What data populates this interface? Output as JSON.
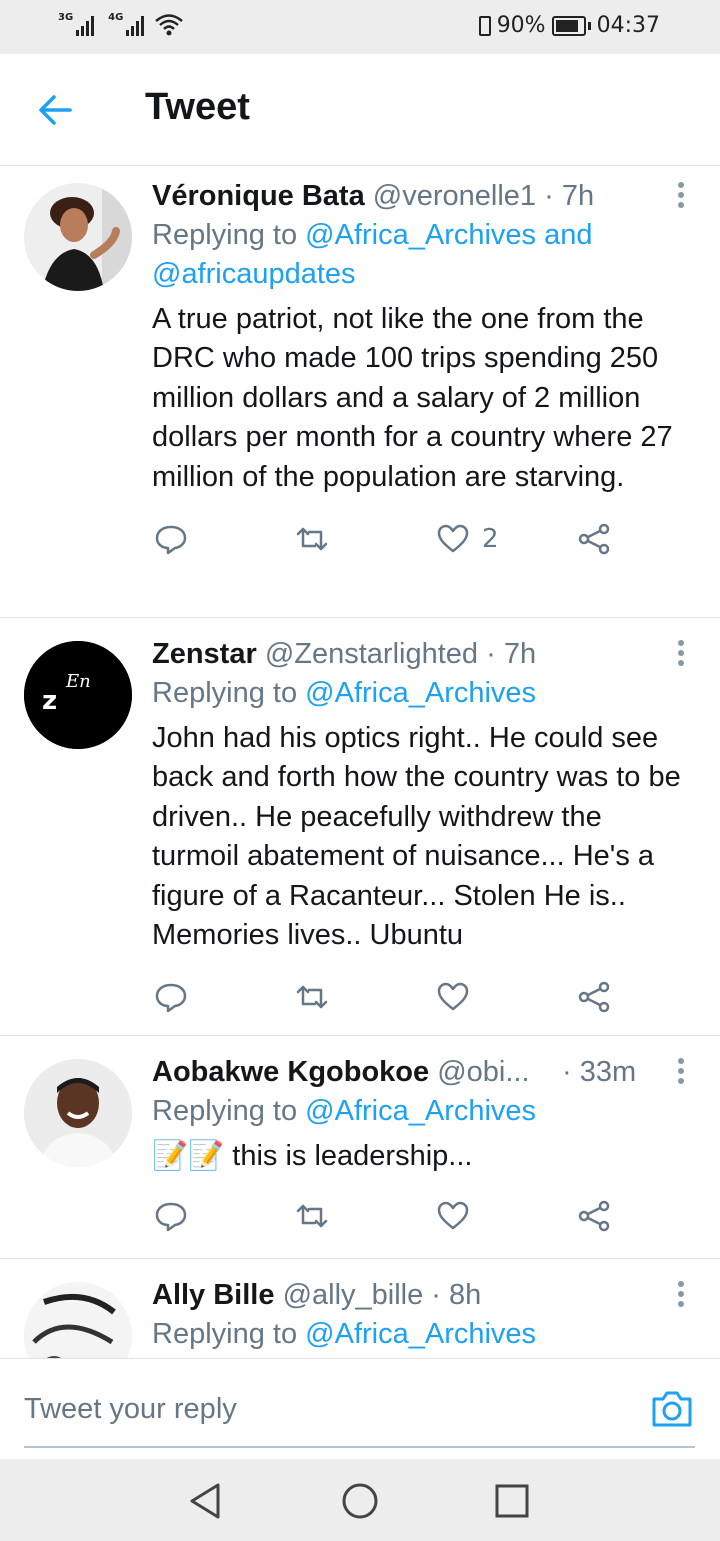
{
  "status_bar": {
    "net1": "3G",
    "net2": "4G",
    "battery": "90%",
    "time": "04:37"
  },
  "header": {
    "title": "Tweet"
  },
  "tweets": [
    {
      "name": "Véronique Bata",
      "handle": "@veronelle1",
      "sep": " · ",
      "time": "7h",
      "replying_prefix": "Replying to ",
      "replying_line1": "@Africa_Archives and",
      "replying_line2": "@africaupdates",
      "text": "A true patriot, not like the one from the DRC who made 100 trips spending 250 million dollars and a salary of 2 million dollars per month for a country where 27 million of the population are starving.",
      "likes": "2"
    },
    {
      "name": "Zenstar",
      "handle": "@Zenstarlighted",
      "sep": " · ",
      "time": "7h",
      "replying_prefix": "Replying to ",
      "replying_line1": "@Africa_Archives",
      "avatar_text_main": "z",
      "avatar_text_sup": "En",
      "text": "John had his optics right.. He could see back and forth how the country was to be driven.. He peacefully withdrew the turmoil abatement of nuisance... He's a figure of a Racanteur... Stolen He is.. Memories lives.. Ubuntu",
      "likes": ""
    },
    {
      "name": "Aobakwe Kgobokoe",
      "handle": "@obi...",
      "sep": " · ",
      "time": "33m",
      "replying_prefix": "Replying to ",
      "replying_line1": "@Africa_Archives",
      "emoji": "📝📝",
      "text": "this is leadership...",
      "likes": ""
    },
    {
      "name": "Ally Bille",
      "handle": "@ally_bille",
      "sep": " · ",
      "time": "8h",
      "replying_prefix": "Replying to ",
      "replying_line1": "@Africa_Archives"
    }
  ],
  "composer": {
    "placeholder": "Tweet your reply"
  },
  "colors": {
    "accent": "#1da1f2",
    "muted": "#657786",
    "text": "#14171a"
  }
}
